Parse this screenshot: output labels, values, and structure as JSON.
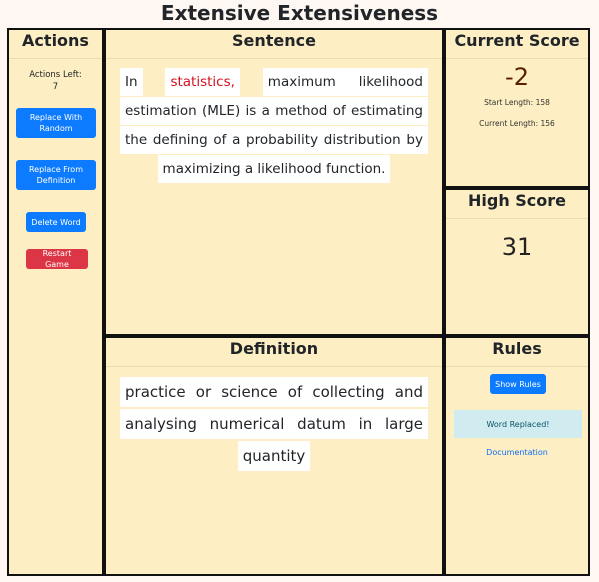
{
  "app": {
    "title": "Extensive Extensiveness"
  },
  "actions": {
    "heading": "Actions",
    "actions_left_label": "Actions Left:",
    "actions_left_value": "7",
    "replace_random": "Replace With Random",
    "replace_definition": "Replace From Definition",
    "delete_word": "Delete Word",
    "restart_game": "Restart Game"
  },
  "sentence": {
    "heading": "Sentence",
    "words_before": "In",
    "highlight": "statistics,",
    "words_after": "maximum likelihood estimation (MLE) is a method of estimating the defining of a probability distribution by maximizing a likelihood function."
  },
  "current_score": {
    "heading": "Current Score",
    "value": "-2",
    "start_length": "Start Length: 158",
    "current_length": "Current Length: 156"
  },
  "high_score": {
    "heading": "High Score",
    "value": "31"
  },
  "definition": {
    "heading": "Definition",
    "text": "practice or science of collecting and analysing numerical datum in large quantity"
  },
  "rules": {
    "heading": "Rules",
    "show_rules": "Show Rules",
    "alert": "Word Replaced!",
    "documentation": "Documentation"
  },
  "colors": {
    "panel": "#fdefc3",
    "primary": "#0d7bff",
    "danger": "#dc3545",
    "highlight": "#d0101f",
    "info_bg": "#d0ecf1"
  }
}
